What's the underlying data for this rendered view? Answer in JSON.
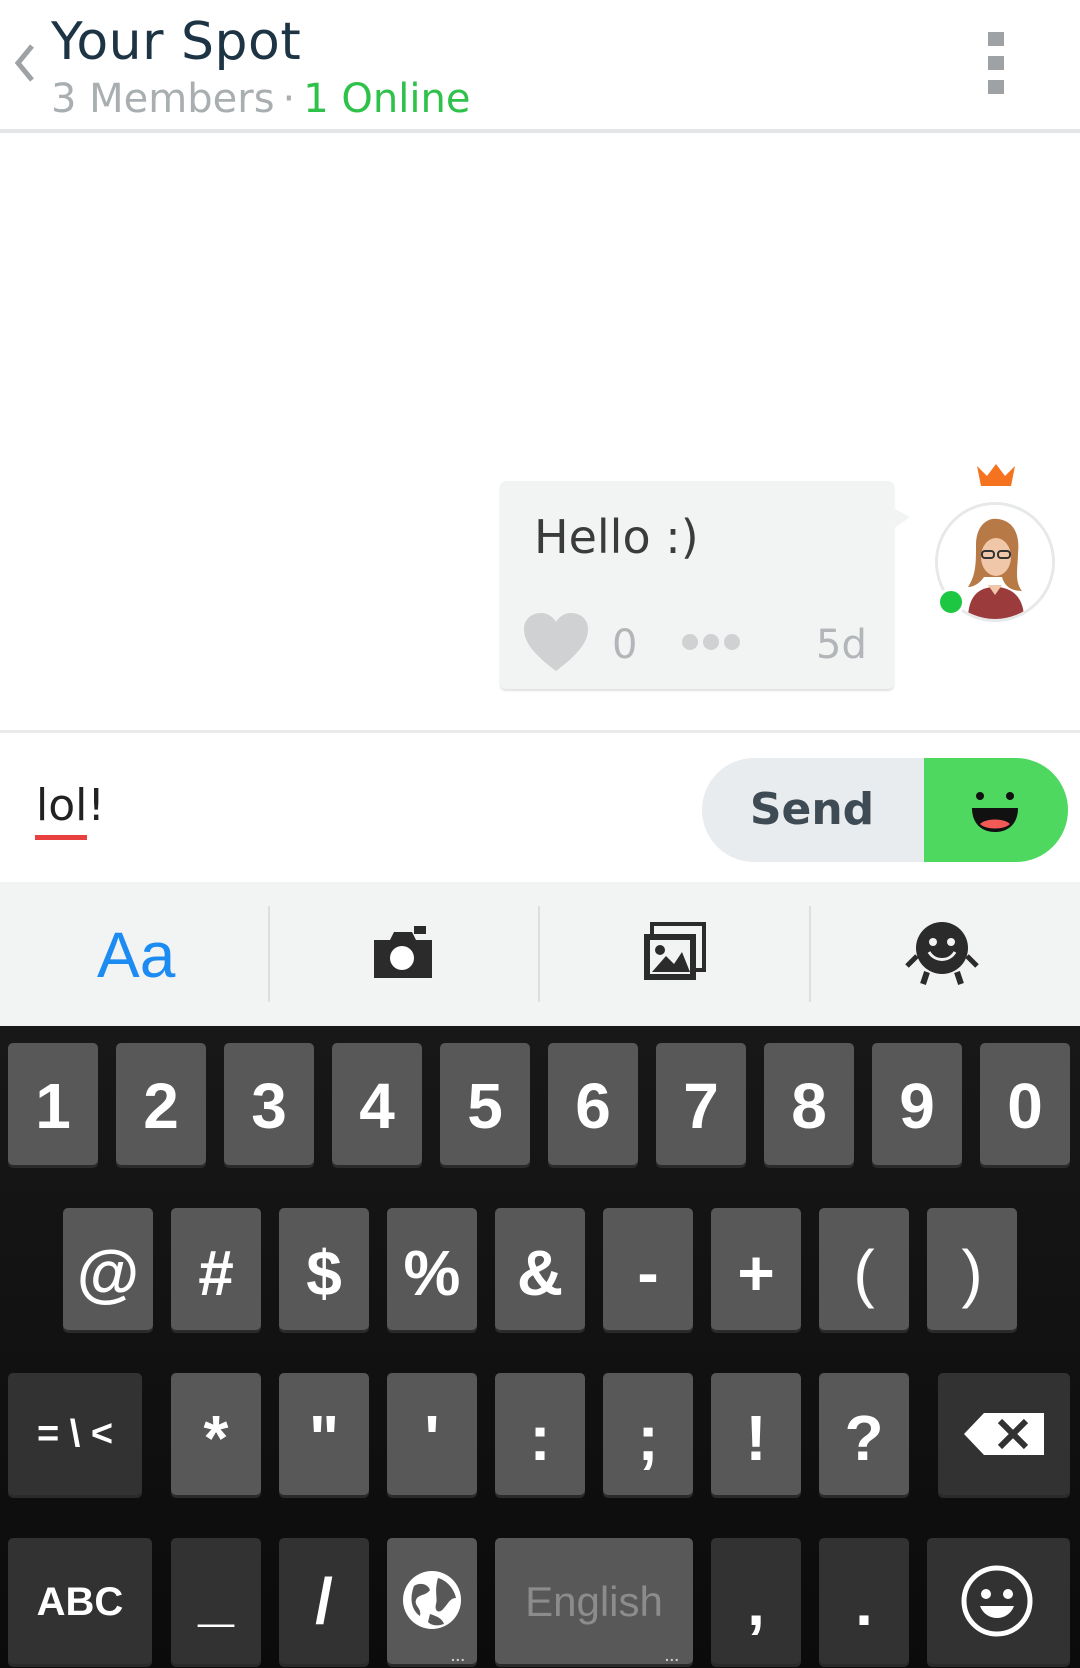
{
  "header": {
    "title": "Your Spot",
    "members": "3 Members",
    "separator": "·",
    "online": "1 Online",
    "back_icon": "chevron-left-icon",
    "menu_icon": "overflow-menu-icon"
  },
  "message": {
    "text": "Hello :)",
    "likes": "0",
    "time": "5d",
    "author_badge": "crown-icon",
    "author_status": "online"
  },
  "composer": {
    "input_value": "lol!",
    "send_label": "Send"
  },
  "toolbar": {
    "font_label": "Aa",
    "items": [
      "font-icon",
      "camera-icon",
      "gallery-icon",
      "sticker-icon"
    ]
  },
  "keyboard": {
    "row1": [
      "1",
      "2",
      "3",
      "4",
      "5",
      "6",
      "7",
      "8",
      "9",
      "0"
    ],
    "row2": [
      "@",
      "#",
      "$",
      "%",
      "&",
      "-",
      "+",
      "(",
      ")"
    ],
    "row3": [
      "= \\ <",
      "*",
      "\"",
      "'",
      ":",
      ";",
      "!",
      "?"
    ],
    "row4": [
      "ABC",
      "_",
      "/",
      "English",
      ",",
      "."
    ],
    "icons": [
      "globe-icon",
      "backspace-icon",
      "emoji-icon"
    ]
  },
  "colors": {
    "online_green": "#2ec24a",
    "accent_blue": "#1c8cf2",
    "send_green": "#4ed85f",
    "crown_orange": "#f5731f",
    "spell_red": "#e8403f"
  }
}
